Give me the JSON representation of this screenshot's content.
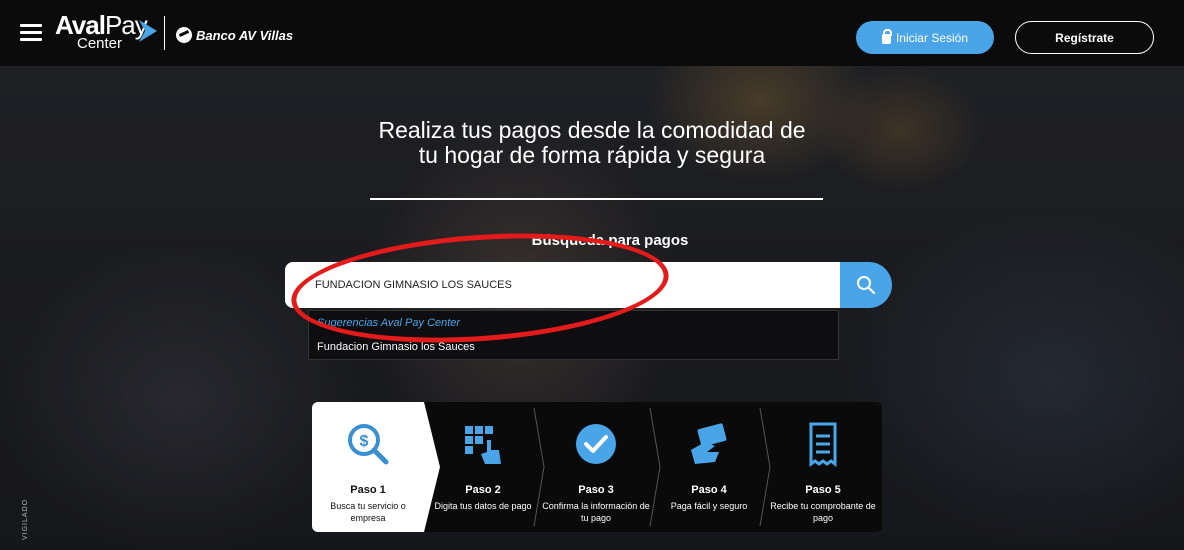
{
  "header": {
    "logo_aval": "Aval",
    "logo_pay": "Pay",
    "logo_center": "Center",
    "bank_name": "Banco AV Villas",
    "login_label": "Iniciar Sesión",
    "register_label": "Regístrate"
  },
  "hero": {
    "title_line1": "Realiza tus pagos desde la comodidad de",
    "title_line2": "tu hogar de forma rápida y segura",
    "search_title": "Búsqueda para pagos"
  },
  "search": {
    "value": "FUNDACION GIMNASIO LOS SAUCES"
  },
  "suggestions": {
    "header": "Sugerencias Aval Pay Center",
    "items": [
      "Fundacion Gimnasio los Sauces"
    ]
  },
  "steps": [
    {
      "name": "Paso 1",
      "desc": "Busca tu servicio o empresa",
      "icon": "search-money-icon"
    },
    {
      "name": "Paso 2",
      "desc": "Digita tus datos de pago",
      "icon": "keypad-hand-icon"
    },
    {
      "name": "Paso 3",
      "desc": "Confirma la información de tu pago",
      "icon": "check-circle-icon"
    },
    {
      "name": "Paso 4",
      "desc": "Paga fácil y seguro",
      "icon": "card-hand-icon"
    },
    {
      "name": "Paso 5",
      "desc": "Recibe tu comprobante de pago",
      "icon": "receipt-icon"
    }
  ],
  "vigilado": "VIGILADO",
  "colors": {
    "accent": "#4aa5e8",
    "annotation": "#e51a1a",
    "header_bg": "#0b0b0c"
  }
}
